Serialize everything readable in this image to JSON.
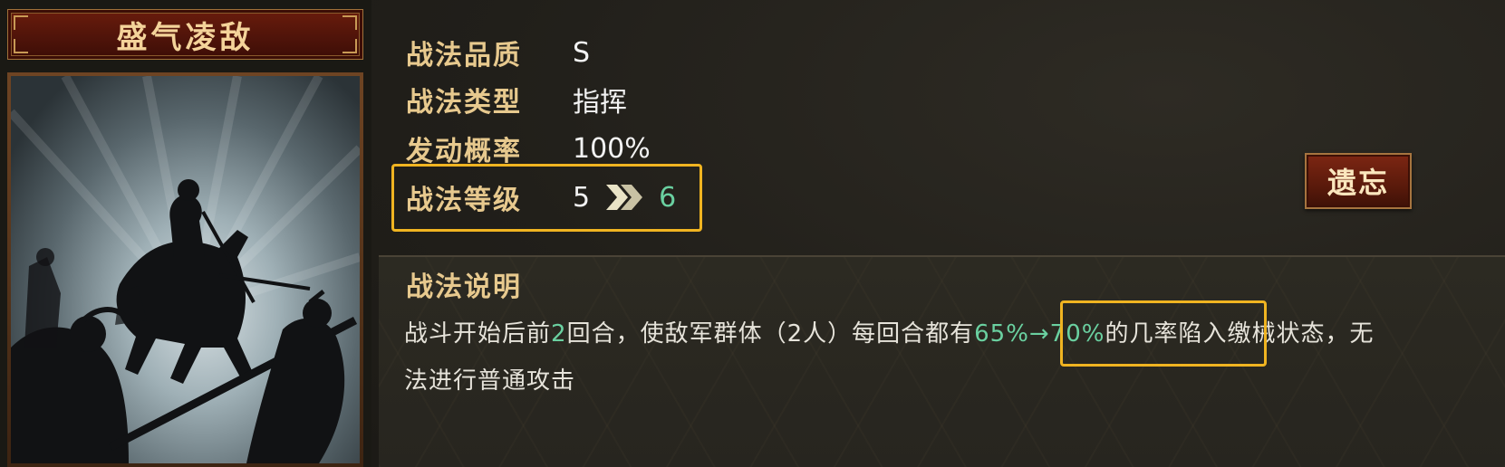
{
  "skill": {
    "name": "盛气凌敌"
  },
  "stats": {
    "quality_label": "战法品质",
    "quality_value": "S",
    "type_label": "战法类型",
    "type_value": "指挥",
    "rate_label": "发动概率",
    "rate_value": "100%",
    "level_label": "战法等级",
    "level_from": "5",
    "level_to": "6"
  },
  "actions": {
    "forget_label": "遗忘"
  },
  "description": {
    "title": "战法说明",
    "part1": "战斗开始后前",
    "turns": "2",
    "part2": "回合，使敌军群体（2人）每回合都有",
    "chance": "65%→70%",
    "part3": "的几率陷入缴械状态，无法进行普通攻击"
  },
  "colors": {
    "gold_label": "#e7c98e",
    "highlight_green": "#6ad0a0",
    "box_outline": "#f0b421",
    "banner_red": "#6a1c0c"
  },
  "icons": {
    "level_arrow": "double-chevron-right-icon"
  }
}
